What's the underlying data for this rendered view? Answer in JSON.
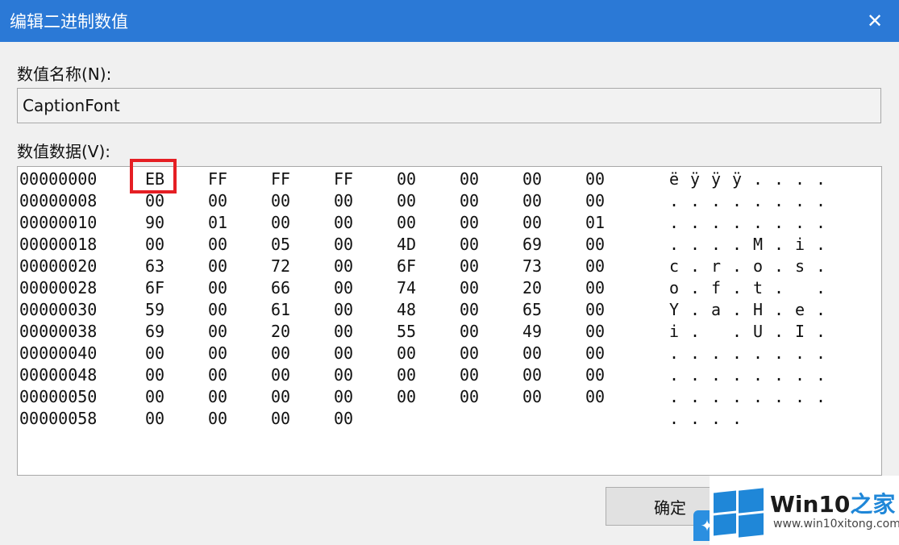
{
  "window": {
    "title": "编辑二进制数值"
  },
  "value_name": {
    "label": "数值名称(N):",
    "value": "CaptionFont"
  },
  "value_data": {
    "label": "数值数据(V):",
    "rows": [
      {
        "offset": "00000000",
        "bytes": [
          "EB",
          "FF",
          "FF",
          "FF",
          "00",
          "00",
          "00",
          "00"
        ],
        "ascii": [
          "ë",
          "ÿ",
          "ÿ",
          "ÿ",
          ".",
          ".",
          ".",
          "."
        ]
      },
      {
        "offset": "00000008",
        "bytes": [
          "00",
          "00",
          "00",
          "00",
          "00",
          "00",
          "00",
          "00"
        ],
        "ascii": [
          ".",
          ".",
          ".",
          ".",
          ".",
          ".",
          ".",
          "."
        ]
      },
      {
        "offset": "00000010",
        "bytes": [
          "90",
          "01",
          "00",
          "00",
          "00",
          "00",
          "00",
          "01"
        ],
        "ascii": [
          ".",
          ".",
          ".",
          ".",
          ".",
          ".",
          ".",
          "."
        ]
      },
      {
        "offset": "00000018",
        "bytes": [
          "00",
          "00",
          "05",
          "00",
          "4D",
          "00",
          "69",
          "00"
        ],
        "ascii": [
          ".",
          ".",
          ".",
          ".",
          "M",
          ".",
          "i",
          "."
        ]
      },
      {
        "offset": "00000020",
        "bytes": [
          "63",
          "00",
          "72",
          "00",
          "6F",
          "00",
          "73",
          "00"
        ],
        "ascii": [
          "c",
          ".",
          "r",
          ".",
          "o",
          ".",
          "s",
          "."
        ]
      },
      {
        "offset": "00000028",
        "bytes": [
          "6F",
          "00",
          "66",
          "00",
          "74",
          "00",
          "20",
          "00"
        ],
        "ascii": [
          "o",
          ".",
          "f",
          ".",
          "t",
          ".",
          " ",
          "."
        ]
      },
      {
        "offset": "00000030",
        "bytes": [
          "59",
          "00",
          "61",
          "00",
          "48",
          "00",
          "65",
          "00"
        ],
        "ascii": [
          "Y",
          ".",
          "a",
          ".",
          "H",
          ".",
          "e",
          "."
        ]
      },
      {
        "offset": "00000038",
        "bytes": [
          "69",
          "00",
          "20",
          "00",
          "55",
          "00",
          "49",
          "00"
        ],
        "ascii": [
          "i",
          ".",
          " ",
          ".",
          "U",
          ".",
          "I",
          "."
        ]
      },
      {
        "offset": "00000040",
        "bytes": [
          "00",
          "00",
          "00",
          "00",
          "00",
          "00",
          "00",
          "00"
        ],
        "ascii": [
          ".",
          ".",
          ".",
          ".",
          ".",
          ".",
          ".",
          "."
        ]
      },
      {
        "offset": "00000048",
        "bytes": [
          "00",
          "00",
          "00",
          "00",
          "00",
          "00",
          "00",
          "00"
        ],
        "ascii": [
          ".",
          ".",
          ".",
          ".",
          ".",
          ".",
          ".",
          "."
        ]
      },
      {
        "offset": "00000050",
        "bytes": [
          "00",
          "00",
          "00",
          "00",
          "00",
          "00",
          "00",
          "00"
        ],
        "ascii": [
          ".",
          ".",
          ".",
          ".",
          ".",
          ".",
          ".",
          "."
        ]
      },
      {
        "offset": "00000058",
        "bytes": [
          "00",
          "00",
          "00",
          "00"
        ],
        "ascii": [
          ".",
          ".",
          ".",
          "."
        ]
      }
    ]
  },
  "buttons": {
    "ok": "确定"
  },
  "watermark": {
    "brand_prefix": "Win10",
    "brand_suffix": "之家",
    "url": "www.win10xitong.com"
  },
  "colors": {
    "titlebar": "#2b79d6",
    "highlight": "#e51f24",
    "logo_blue": "#1f87d8"
  },
  "icons": {
    "close": "close-icon",
    "logo": "windows-logo-icon",
    "bird": "bird-icon"
  }
}
